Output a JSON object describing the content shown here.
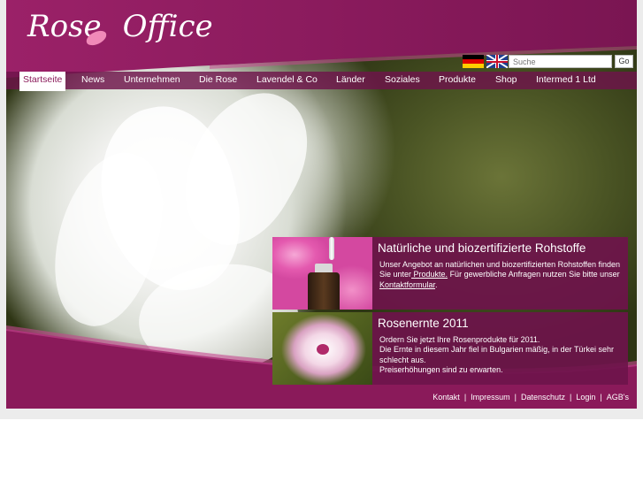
{
  "logo": {
    "text_left": "Rose",
    "text_right": "Office"
  },
  "search": {
    "placeholder": "Suche",
    "go_label": "Go"
  },
  "nav": {
    "items": [
      {
        "label": "Startseite",
        "active": true
      },
      {
        "label": "News"
      },
      {
        "label": "Unternehmen"
      },
      {
        "label": "Die Rose"
      },
      {
        "label": "Lavendel & Co"
      },
      {
        "label": "Länder"
      },
      {
        "label": "Soziales"
      },
      {
        "label": "Produkte"
      },
      {
        "label": "Shop"
      },
      {
        "label": "Intermed 1 Ltd"
      }
    ]
  },
  "boxes": [
    {
      "title": "Natürliche und biozertifizierte Rohstoffe",
      "text_1": "Unser Angebot an natürlichen und biozertifizierten  Rohstoffen finden Sie unter",
      "link_1": " Produkte.",
      "text_2": " Für gewerbliche Anfragen nutzen Sie bitte unser",
      "link_2": "Kontaktformular",
      "text_3": "."
    },
    {
      "title": "Rosenernte 2011",
      "line_1": "Ordern Sie jetzt Ihre Rosenprodukte für 2011.",
      "line_2": "Die Ernte in diesem Jahr fiel in Bulgarien mäßig, in der Türkei sehr schlecht aus.",
      "line_3": "Preiserhöhungen sind zu erwarten."
    }
  ],
  "footer": {
    "links": [
      "Kontakt",
      "Impressum",
      "Datenschutz",
      "Login",
      "AGB's"
    ],
    "separator": "|"
  },
  "colors": {
    "brand_purple": "#8a1a5a",
    "nav_bg": "#6e144b",
    "accent_pink": "#f08ab8"
  }
}
